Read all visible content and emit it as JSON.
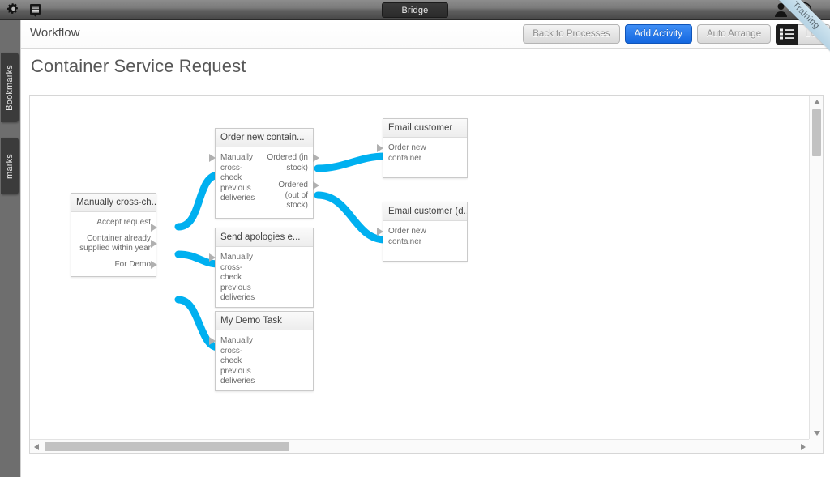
{
  "chrome": {
    "gear_icon": "gear-icon",
    "list_menu_icon": "list-menu-icon",
    "tab_label": "Bridge",
    "person_icon": "person-icon",
    "play_icon": "play-icon",
    "ribbon_label": "Training"
  },
  "rail": {
    "tabs": [
      {
        "label": "Bookmarks",
        "name": "rail-tab-bookmarks"
      },
      {
        "label": "marks",
        "name": "rail-tab-marks"
      }
    ]
  },
  "toolbar": {
    "section_label": "Workflow",
    "back_label": "Back to Processes",
    "add_activity_label": "Add Activity",
    "auto_arrange_label": "Auto Arrange",
    "list_label": "List",
    "list_icon": "list-view-icon",
    "accent_color": "#1367e0"
  },
  "page": {
    "title": "Container Service Request"
  },
  "canvas": {
    "connector_color": "#00b0f0",
    "arrow_color": "#b0b0b0",
    "vscroll_up_icon": "scroll-up-icon",
    "vscroll_down_icon": "scroll-down-icon",
    "hscroll_left_icon": "scroll-left-icon",
    "hscroll_right_icon": "scroll-right-icon"
  },
  "diagram": {
    "nodes": [
      {
        "id": "n1",
        "title": "Manually cross-ch...",
        "inputs": [],
        "outputs": [
          "Accept request",
          "Container already supplied within year",
          "For Demo"
        ]
      },
      {
        "id": "n2",
        "title": "Order new contain...",
        "inputs": [
          "Manually cross-check previous deliveries"
        ],
        "outputs": [
          "Ordered (in stock)",
          "Ordered (out of stock)"
        ]
      },
      {
        "id": "n3",
        "title": "Send apologies e...",
        "inputs": [
          "Manually cross-check previous deliveries"
        ],
        "outputs": []
      },
      {
        "id": "n4",
        "title": "My Demo Task",
        "inputs": [
          "Manually cross-check previous deliveries"
        ],
        "outputs": []
      },
      {
        "id": "n5",
        "title": "Email customer",
        "inputs": [
          "Order new container"
        ],
        "outputs": []
      },
      {
        "id": "n6",
        "title": "Email customer (d...",
        "inputs": [
          "Order new container"
        ],
        "outputs": []
      }
    ],
    "edges": [
      {
        "from": "n1.out0",
        "to": "n2.in0"
      },
      {
        "from": "n1.out1",
        "to": "n3.in0"
      },
      {
        "from": "n1.out2",
        "to": "n4.in0"
      },
      {
        "from": "n2.out0",
        "to": "n5.in0"
      },
      {
        "from": "n2.out1",
        "to": "n6.in0"
      }
    ]
  }
}
